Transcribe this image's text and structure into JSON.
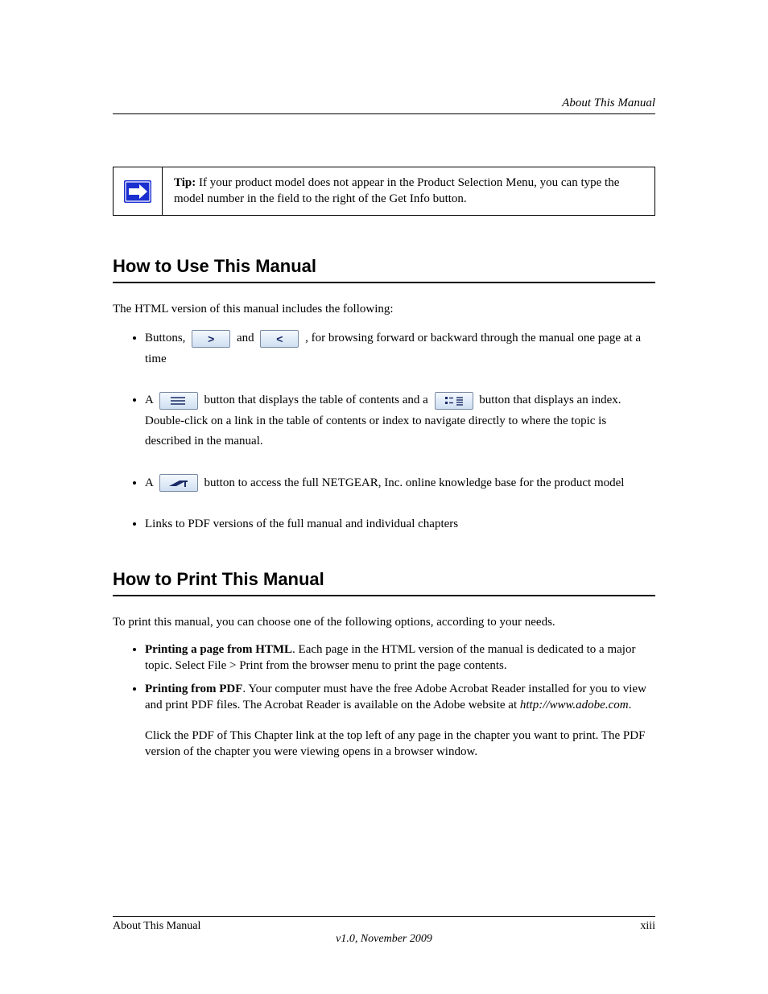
{
  "header": {
    "running_title": "About This Manual"
  },
  "note": {
    "label": "Tip:",
    "text": " If your product model does not appear in the Product Selection Menu, you can type the model number in the field to the right of the Get Info button."
  },
  "sections": {
    "doc_title": "How to Use This Manual",
    "doc_intro": "The HTML version of this manual includes the following:",
    "icon_items": [
      {
        "pre": "Buttons, ",
        "mid": " and ",
        "post": ", for browsing forward or backward through the manual one page at a time"
      },
      {
        "pre": "A ",
        "mid": " button that displays the table of contents and a ",
        "post": " button that displays an index. Double-click on a link in the table of contents or index to navigate directly to where the topic is described in the manual."
      },
      {
        "pre": "A ",
        "post": " button to access the full NETGEAR, Inc. online knowledge base for the product model"
      },
      {
        "text": "Links to PDF versions of the full manual and individual chapters"
      }
    ],
    "print_title": "How to Print This Manual",
    "print_intro": "To print this manual, you can choose one of the following options, according to your needs.",
    "print_items": [
      {
        "bold": "Printing a page from HTML",
        "rest": ". Each page in the HTML version of the manual is dedicated to a major topic. Select File > Print from the browser menu to print the page contents."
      },
      {
        "bold": "Printing from PDF",
        "rest": ". Your computer must have the free Adobe Acrobat Reader installed for you to view and print PDF files. The Acrobat Reader is available on the Adobe website at ",
        "link": "http://www.adobe.com",
        "tail": "."
      }
    ],
    "print_sub": "Click the PDF of This Chapter link at the top left of any page in the chapter you want to print. The PDF version of the chapter you were viewing opens in a browser window."
  },
  "footer": {
    "left": "About This Manual",
    "version": "v1.0, November 2009",
    "page": "xiii"
  }
}
